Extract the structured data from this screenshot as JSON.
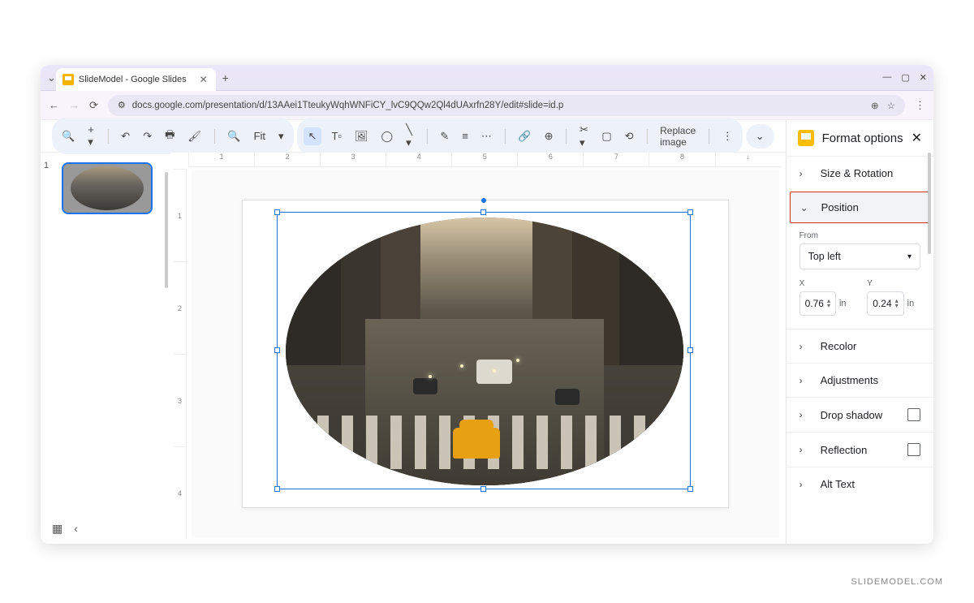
{
  "browser": {
    "tab_title": "SlideModel - Google Slides",
    "url": "docs.google.com/presentation/d/13AAei1TteukyWqhWNFiCY_lvC9QQw2Ql4dUAxrfn28Y/edit#slide=id.p"
  },
  "toolbar": {
    "zoom_label": "Fit",
    "replace_image": "Replace image"
  },
  "ruler_h": [
    "1",
    "2",
    "3",
    "4",
    "5",
    "6",
    "7",
    "8",
    "↓"
  ],
  "ruler_v": [
    "1",
    "2",
    "3",
    "4"
  ],
  "thumb_number": "1",
  "panel": {
    "title": "Format options",
    "size_rotation": "Size & Rotation",
    "position": "Position",
    "from_label": "From",
    "from_value": "Top left",
    "x_label": "X",
    "x_value": "0.76",
    "x_unit": "in",
    "y_label": "Y",
    "y_value": "0.24",
    "y_unit": "in",
    "recolor": "Recolor",
    "adjustments": "Adjustments",
    "drop_shadow": "Drop shadow",
    "reflection": "Reflection",
    "alt_text": "Alt Text"
  },
  "watermark": "SLIDEMODEL.COM"
}
